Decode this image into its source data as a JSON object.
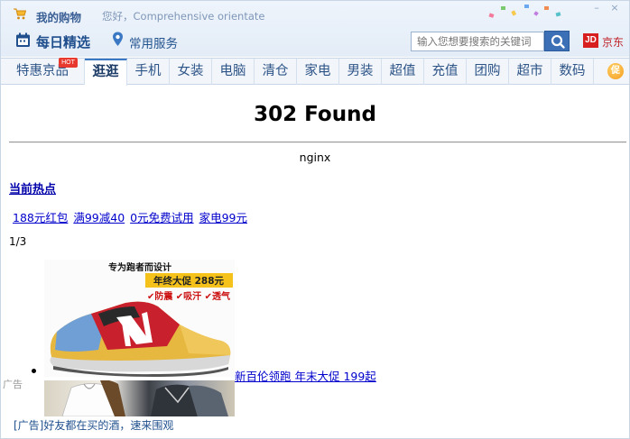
{
  "header": {
    "my_shopping": "我的购物",
    "greeting": "您好，Comprehensive orientate",
    "daily_picks": "每日精选",
    "common_services": "常用服务",
    "search_placeholder": "输入您想要搜索的关键词",
    "jd_logo": "JD",
    "jd_label": "京东"
  },
  "nav": {
    "hot_badge": "HOT",
    "promo_icon": "促",
    "tabs": [
      "特惠京品",
      "逛逛",
      "手机",
      "女装",
      "电脑",
      "清仓",
      "家电",
      "男装",
      "超值",
      "充值",
      "团购",
      "超市",
      "数码"
    ]
  },
  "content": {
    "title": "302 Found",
    "server": "nginx",
    "hot_now": "当前热点",
    "links": [
      "188元红包",
      "满99减40",
      "0元免费试用",
      "家电99元"
    ],
    "pager": "1/3",
    "ad_label": "广告",
    "shoe_banner_line1": "专为跑者而设计",
    "shoe_banner_line2": "年终大促 288元",
    "shoe_banner_line3": "✔防震 ✔吸汗 ✔透气",
    "shoe_link": "新百伦领跑 年末大促 199起",
    "bottom_ad": "[广告]好友都在买的酒，速来围观"
  },
  "colors": {
    "accent": "#3b78c4",
    "link": "#0000cc",
    "hot": "#e8392e",
    "jd_red": "#d71f1f"
  }
}
